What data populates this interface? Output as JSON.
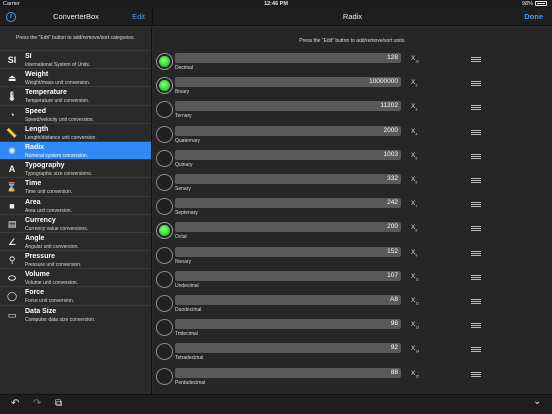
{
  "status": {
    "carrier": "Carrier",
    "time": "12:46 PM",
    "battery": "98%"
  },
  "left_nav": {
    "title": "ConverterBox",
    "edit_label": "Edit",
    "info_glyph": "i"
  },
  "right_nav": {
    "title": "Radix",
    "done_label": "Done"
  },
  "left_hint": "Press the \"Edit\" button to add/remove/sort categories.",
  "right_hint": "Press the \"Edit\" button to add/remove/sort units.",
  "categories": [
    {
      "name": "SI",
      "desc": "International System of Units.",
      "icon": "si-icon",
      "glyph": "SI",
      "selected": false
    },
    {
      "name": "Weight",
      "desc": "Weight/mass unit conversion.",
      "icon": "weight-icon",
      "glyph": "⏏",
      "selected": false
    },
    {
      "name": "Temperature",
      "desc": "Temperature unit conversion.",
      "icon": "thermometer-icon",
      "glyph": "🌡",
      "selected": false
    },
    {
      "name": "Speed",
      "desc": "Speed/velocity unit conversion.",
      "icon": "speedometer-icon",
      "glyph": "◔",
      "selected": false
    },
    {
      "name": "Length",
      "desc": "Length/distance unit conversion.",
      "icon": "ruler-icon",
      "glyph": "📏",
      "selected": false
    },
    {
      "name": "Radix",
      "desc": "Numeral system conversion.",
      "icon": "radix-icon",
      "glyph": "✺",
      "selected": true
    },
    {
      "name": "Typography",
      "desc": "Typographic size conversions.",
      "icon": "typography-icon",
      "glyph": "A",
      "selected": false
    },
    {
      "name": "Time",
      "desc": "Time unit conversion.",
      "icon": "hourglass-icon",
      "glyph": "⌛",
      "selected": false
    },
    {
      "name": "Area",
      "desc": "Area unit conversion.",
      "icon": "area-icon",
      "glyph": "■",
      "selected": false
    },
    {
      "name": "Currency",
      "desc": "Currency value conversions.",
      "icon": "currency-icon",
      "glyph": "▤",
      "selected": false
    },
    {
      "name": "Angle",
      "desc": "Angular unit conversion.",
      "icon": "angle-icon",
      "glyph": "∠",
      "selected": false
    },
    {
      "name": "Pressure",
      "desc": "Pressure unit conversion.",
      "icon": "pressure-icon",
      "glyph": "⚲",
      "selected": false
    },
    {
      "name": "Volume",
      "desc": "Volume unit conversion.",
      "icon": "volume-icon",
      "glyph": "⬭",
      "selected": false
    },
    {
      "name": "Force",
      "desc": "Force unit conversion.",
      "icon": "force-icon",
      "glyph": "◯",
      "selected": false
    },
    {
      "name": "Data Size",
      "desc": "Computer data size conversion.",
      "icon": "data-size-icon",
      "glyph": "▭",
      "selected": false
    }
  ],
  "units": [
    {
      "label": "Decimal",
      "value": "128",
      "sub": "10",
      "on": true
    },
    {
      "label": "Binary",
      "value": "10000000",
      "sub": "2",
      "on": true
    },
    {
      "label": "Ternary",
      "value": "11202",
      "sub": "3",
      "on": false
    },
    {
      "label": "Quaternary",
      "value": "2000",
      "sub": "4",
      "on": false
    },
    {
      "label": "Quinary",
      "value": "1003",
      "sub": "5",
      "on": false
    },
    {
      "label": "Senary",
      "value": "332",
      "sub": "6",
      "on": false
    },
    {
      "label": "Septenary",
      "value": "242",
      "sub": "7",
      "on": false
    },
    {
      "label": "Octal",
      "value": "200",
      "sub": "8",
      "on": true
    },
    {
      "label": "Nonary",
      "value": "152",
      "sub": "9",
      "on": false
    },
    {
      "label": "Undecimal",
      "value": "107",
      "sub": "11",
      "on": false
    },
    {
      "label": "Duodecimal",
      "value": "A8",
      "sub": "12",
      "on": false
    },
    {
      "label": "Tridecimal",
      "value": "98",
      "sub": "13",
      "on": false
    },
    {
      "label": "Tetradecimal",
      "value": "92",
      "sub": "14",
      "on": false
    },
    {
      "label": "Pentadecimal",
      "value": "88",
      "sub": "15",
      "on": false
    }
  ],
  "unit_symbol": "X",
  "toolbar": {
    "undo_glyph": "↶",
    "redo_glyph": "↷",
    "copy_glyph": "⧉",
    "collapse_glyph": "⌄"
  },
  "colors": {
    "accent": "#3d9bff",
    "selected": "#2f8af5",
    "radio_on": "#2fdc35"
  }
}
